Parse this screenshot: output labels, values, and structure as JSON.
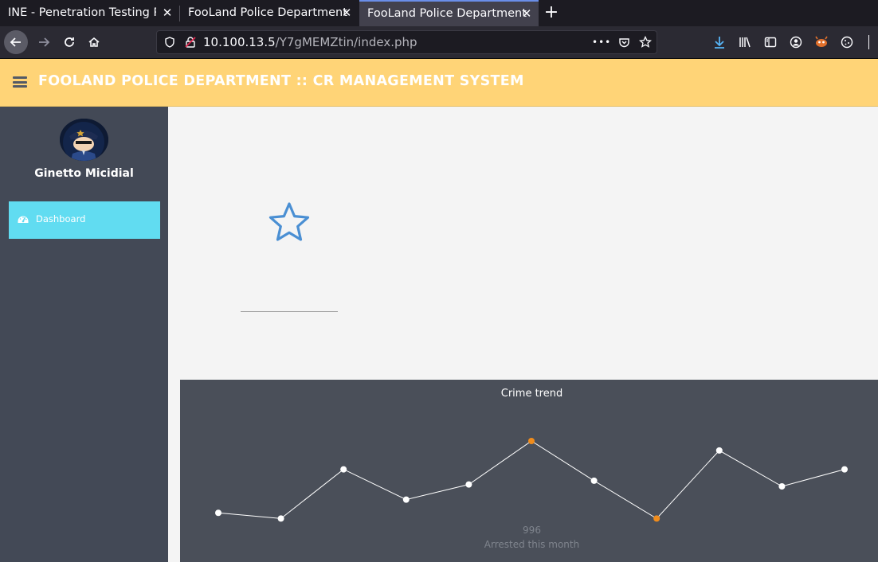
{
  "browser": {
    "tabs": [
      {
        "title": "INE - Penetration Testing Pr",
        "close": "✕",
        "active": false
      },
      {
        "title": "FooLand Police Department",
        "close": "✕",
        "active": false
      },
      {
        "title": "FooLand Police Department",
        "close": "✕",
        "active": true
      }
    ],
    "new_tab": "+",
    "url_host": "10.100.13.5",
    "url_path": "/Y7gMEMZtin/index.php",
    "url_more": "•••",
    "icons": [
      "back-icon",
      "forward-icon",
      "reload-icon",
      "home-icon",
      "shield-icon",
      "insecure-lock-icon",
      "pocket-icon",
      "bookmark-star-icon",
      "download-icon",
      "library-icon",
      "sidebar-icon",
      "account-icon",
      "extension-icon",
      "cookie-icon",
      "menu-icon"
    ]
  },
  "app": {
    "title": "FOOLAND POLICE DEPARTMENT :: CR MANAGEMENT SYSTEM",
    "header_color": "#ffd477",
    "sidebar_color": "#434956",
    "accent_color": "#61dcf1"
  },
  "sidebar": {
    "user_name": "Ginetto Micidial",
    "items": [
      {
        "label": "Dashboard",
        "icon": "dashboard-icon",
        "active": true
      }
    ]
  },
  "main": {
    "widget_icon": "star-icon"
  },
  "chart_data": {
    "type": "line",
    "title": "Crime trend",
    "x": [
      1,
      2,
      3,
      4,
      5,
      6,
      7,
      8,
      9,
      10,
      11
    ],
    "series": [
      {
        "values": [
          38,
          35,
          61,
          45,
          53,
          76,
          55,
          35,
          71,
          52,
          61
        ],
        "highlighted_indices": [
          5,
          7
        ]
      }
    ],
    "point_color": "#ffffff",
    "highlight_color": "#f08c1c",
    "line_color": "#ffffff",
    "ylim": [
      20,
      100
    ],
    "grid": false,
    "stat_value": "996",
    "stat_label": "Arrested this month"
  }
}
